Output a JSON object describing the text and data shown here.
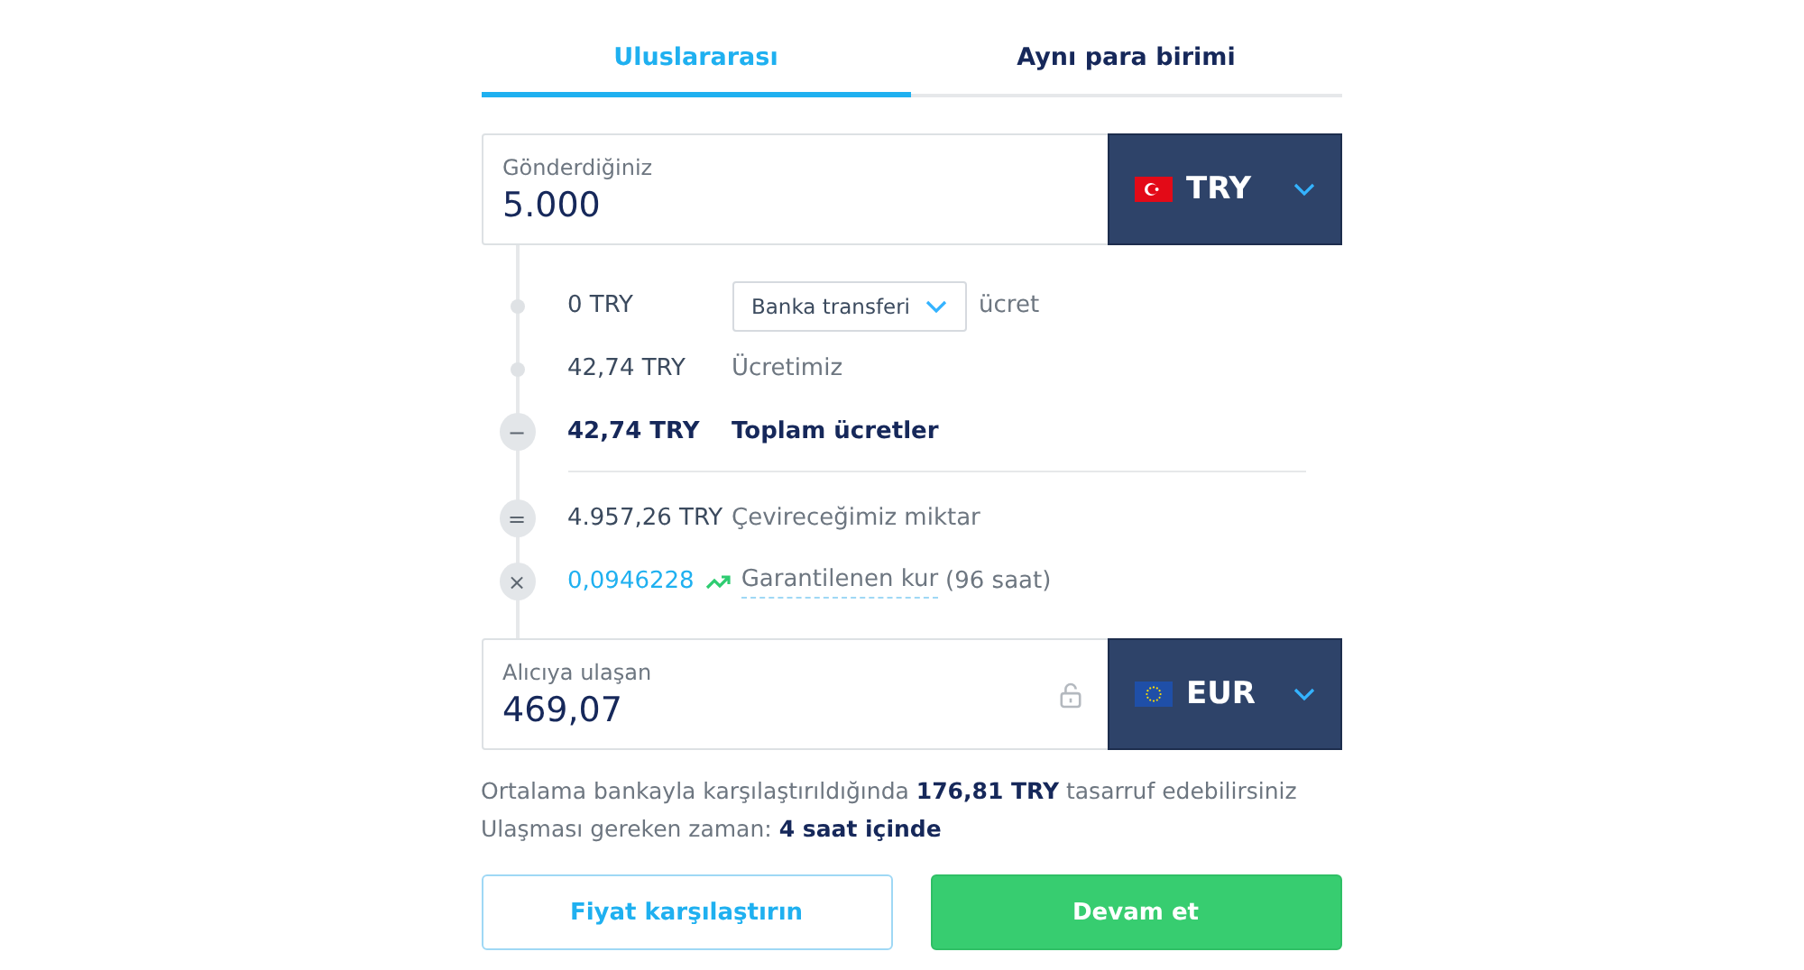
{
  "tabs": [
    {
      "label": "Uluslararası",
      "selected": true
    },
    {
      "label": "Aynı para birimi",
      "selected": false
    }
  ],
  "send": {
    "label": "Gönderdiğiniz",
    "value": "5.000",
    "currency": "TRY"
  },
  "fees": [
    {
      "marker": {
        "kind": "dot"
      },
      "amount": "0 TRY",
      "method": "Banka transferi",
      "label": "ücret",
      "emphasis": false
    },
    {
      "marker": {
        "kind": "dot"
      },
      "amount": "42,74 TRY",
      "label": "Ücretimiz",
      "emphasis": false
    },
    {
      "marker": {
        "kind": "sign",
        "sign": "−"
      },
      "amount": "42,74 TRY",
      "label": "Toplam ücretler",
      "emphasis": true
    }
  ],
  "conversion": [
    {
      "marker": {
        "kind": "sign",
        "sign": "="
      },
      "amount": "4.957,26 TRY",
      "label": "Çevireceğimiz miktar",
      "kind": "plain"
    },
    {
      "marker": {
        "kind": "sign",
        "sign": "×"
      },
      "amount": "0,0946228",
      "label": "Garantilenen kur",
      "suffix": "(96 saat)",
      "kind": "rate"
    }
  ],
  "receive": {
    "label": "Alıcıya ulaşan",
    "value": "469,07",
    "currency": "EUR"
  },
  "savings": "Ortalama bankayla karşılaştırıldığında **176,81 TRY** tasarruf edebilirsiniz",
  "arrival": "Ulaşması gereken zaman: **4 saat içinde**",
  "buttons": [
    {
      "label": "Fiyat karşılaştırın",
      "kind": "secondary"
    },
    {
      "label": "Devam et",
      "kind": "primary"
    }
  ]
}
